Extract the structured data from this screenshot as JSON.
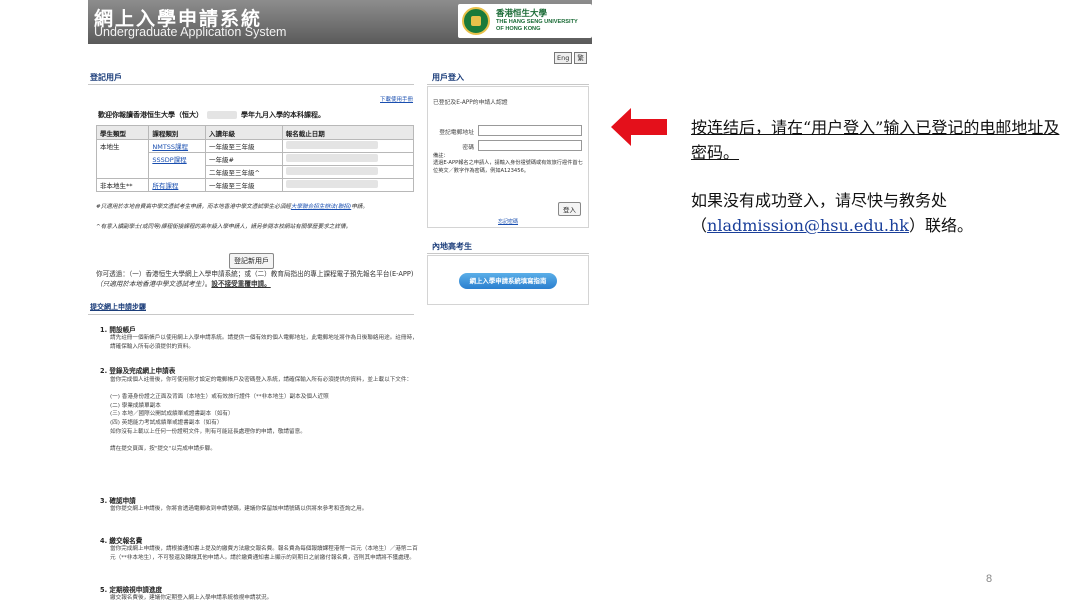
{
  "banner": {
    "title_zh": "網上入學申請系統",
    "title_en": "Undergraduate Application System",
    "logo_zh": "香港恒生大學",
    "logo_en_1": "THE HANG SENG UNIVERSITY",
    "logo_en_2": "OF HONG KONG"
  },
  "lang_switch": [
    "Eng",
    "繁"
  ],
  "registered": {
    "heading": "登記用戶",
    "download_link": "下載使用手冊",
    "intro_pre": "歡迎你報讀香港恒生大學（恒大）",
    "intro_post": "學年九月入學的本科課程。",
    "table": {
      "headers": [
        "學生類型",
        "課程類別",
        "入讀年級",
        "報名截止日期"
      ],
      "rows": [
        {
          "type": "本地生",
          "category": "NMTSS課程",
          "year": "一年級至三年級"
        },
        {
          "type": "",
          "category": "SSSDP課程",
          "year": "一年級#"
        },
        {
          "type": "",
          "category": "",
          "year": "二年級至三年級^"
        },
        {
          "type": "非本地生**",
          "category": "所有課程",
          "year": "一年級至三年級"
        }
      ]
    },
    "note1_a": "#只適用於本地自費高中學文憑試考生申請，而本地香港中學文憑試學生必須經",
    "note1_link": "大學聯合招生辦法(聯招)",
    "note1_b": "申請。",
    "note2": "^有意入讀副學士(或同等)課程銜接課程的高年級入學申請人，請另參閱本校網站有關學歷要求之詳情。",
    "new_user_btn": "登記新用戶",
    "via_1": "你可透過：（一）香港恒生大學網上入學申請系統；或（二）教育局指出的專上課程電子預先報名平台(E-APP)",
    "via_em": "（只適用於本地香港中學文憑試考生）",
    "via_sep": "。",
    "via_ul": "設不接受重覆申請。",
    "steps_heading": "提交網上申請步驟",
    "steps": [
      {
        "title": "1.  開設帳戶",
        "body": "請先註冊一個新帳戶以使用網上入學申請系統。請提供一個有效的個人電郵地址，此電郵地址將作為日後聯絡用途。註冊時，請確保輸入所有必須提供的資料。"
      },
      {
        "title": "2.  登錄及完成網上申請表",
        "body": "當你完成個人註冊後，你可使用剛才設定的電郵帳戶及密碼登入系統，請確保輸入所有必須提供的資料，並上載以下文件：\n\n(一) 香港身份證之正面及背面（本地生）或有效旅行證件（**非本地生）副本及個人近照\n(二) 學業成績單副本\n(三) 本地／國際公開試成績單或證書副本（如有）\n(四) 英語能力考試成績單或證書副本（如有）\n如你沒有上載以上任何一份證明文件，則有可能延長處理你的申請，敬請留意。\n\n請在提交頁面，按\"提交\"以完成申請步驟。"
      },
      {
        "title": "3.  確認申請",
        "body": "當你提交網上申請後，你將會透過電郵收到申請號碼，建議你保留該申請號碼以供將來參考和查詢之用。"
      },
      {
        "title": "4.  繳交報名費",
        "body": "當你完成網上申請後，請根據通知書上提及的繳費方法繳交報名費。報名費為每個報讀課程港幣一百元（本地生）／港幣二百元（**非本地生），不可發還及轉讓其他申請人。請於繳費通知書上顯示的到期日之前繳付報名費，否則其申請將不獲處理。"
      },
      {
        "title": "5.  定期檢視申請進度",
        "body": "繳交報名費後，建議你定期登入網上入學申請系統檢視申請狀況。"
      }
    ]
  },
  "login": {
    "heading": "用戶登入",
    "hint": "已登記及E-APP的申請人認證",
    "email_label": "登記電郵地址",
    "password_label": "密碼",
    "email_value": "",
    "password_value": "",
    "note": "備註：\n透過E-APP報名之申請人，請輸入身份證號碼或有效旅行證件首七位英文／數字作為密碼，例如A123456。",
    "submit": "登入",
    "forgot": "忘記密碼"
  },
  "mainland": {
    "heading": "內地高考生",
    "guide_btn": "網上入學申請系統填寫指南"
  },
  "annotation": {
    "line1": "按连结后，请在“用户登入”输入已登记的电邮地址及密码。",
    "line2_pre": "如果没有成功登入，请尽快与教务处（",
    "line2_mail": "nladmission@hsu.edu.hk",
    "line2_post": "）联络。",
    "arrow_color": "#e4101b"
  },
  "page_number": "8"
}
